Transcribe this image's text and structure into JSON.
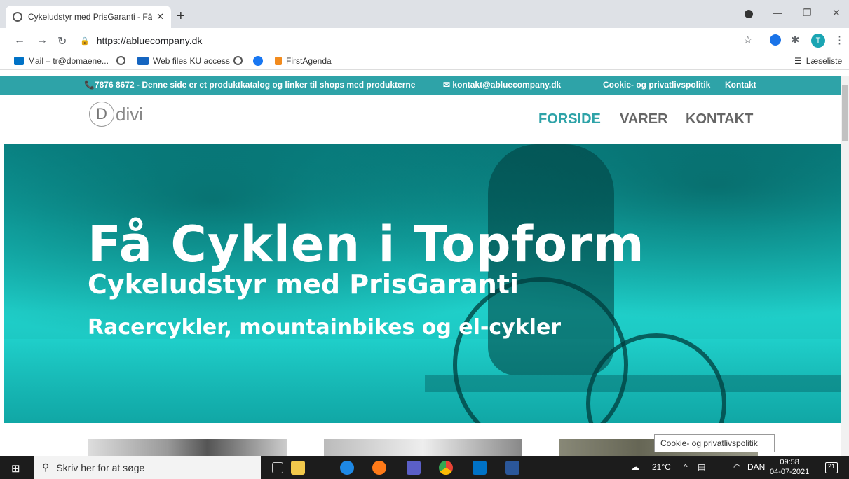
{
  "browser": {
    "tab_title": "Cykeludstyr med PrisGaranti - Få",
    "tab_close": "✕",
    "new_tab": "+",
    "url": "https://abluecompany.dk",
    "avatar_letter": "T",
    "bookmarks": [
      {
        "label": "Mail – tr@domaene..."
      },
      {
        "label": ""
      },
      {
        "label": "Web files KU access"
      },
      {
        "label": ""
      },
      {
        "label": ""
      },
      {
        "label": "FirstAgenda"
      }
    ],
    "reading_list": "Læseliste"
  },
  "site": {
    "topbar": {
      "phone": "📞7876 8672 - Denne side er et produktkatalog og linker til shops med produkterne",
      "email": "✉ kontakt@abluecompany.dk",
      "cookie_link": "Cookie- og privatlivspolitik",
      "contact_link": "Kontakt"
    },
    "logo_letter": "D",
    "logo_text": "divi",
    "nav": [
      {
        "label": "FORSIDE"
      },
      {
        "label": "VARER"
      },
      {
        "label": "KONTAKT"
      }
    ],
    "hero": {
      "title": "Få Cyklen i Topform",
      "subtitle": "Cykeludstyr med PrisGaranti",
      "tagline": "Racercykler, mountainbikes og el-cykler"
    },
    "tooltip": "Cookie- og privatlivspolitik"
  },
  "taskbar": {
    "search_placeholder": "Skriv her for at søge",
    "weather": "21°C",
    "language": "DAN",
    "time": "09:58",
    "date": "04-07-2021",
    "notifications": "21"
  },
  "colors": {
    "accent": "#2ea3a8",
    "hero": "#1fcfc9"
  }
}
